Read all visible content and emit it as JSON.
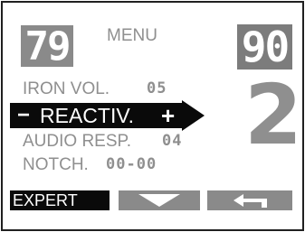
{
  "menu": {
    "title": "MENU",
    "left_value": "79",
    "right_value": "90",
    "big_digit": "2",
    "rows": [
      {
        "label": "IRON VOL.",
        "value": "05"
      },
      {
        "label": "REACTIV.",
        "value": "",
        "selected": true,
        "decrement": "−",
        "increment": "+"
      },
      {
        "label": "AUDIO RESP.",
        "value": "04"
      },
      {
        "label": "NOTCH.",
        "value": "00-00"
      }
    ]
  },
  "softkeys": {
    "left_label": "EXPERT",
    "middle_icon": "chevron-down-icon",
    "right_icon": "back-arrow-icon"
  },
  "colors": {
    "segment_bg": "#8a8a8a",
    "text_gray": "#8f8f8f",
    "selection": "#0a0a0a"
  }
}
